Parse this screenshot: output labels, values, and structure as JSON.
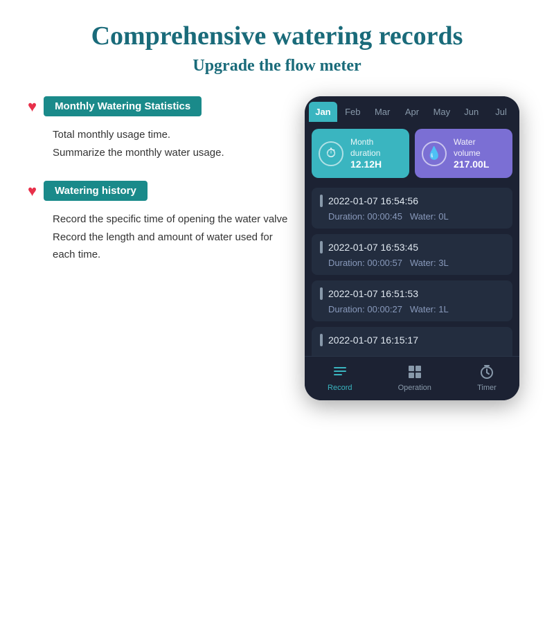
{
  "header": {
    "main_title": "Comprehensive watering records",
    "subtitle": "Upgrade the flow meter"
  },
  "features": [
    {
      "id": "monthly-stats",
      "badge": "Monthly Watering Statistics",
      "description_line1": "Total monthly usage time.",
      "description_line2": "Summarize the monthly water usage."
    },
    {
      "id": "watering-history",
      "badge": "Watering history",
      "description_line1": "Record the specific time of opening the water valve",
      "description_line2": "Record the length and amount of water used for each time."
    }
  ],
  "phone": {
    "months": [
      "Jan",
      "Feb",
      "Mar",
      "Apr",
      "May",
      "Jun",
      "Jul"
    ],
    "active_month": "Jan",
    "stats": [
      {
        "label": "Month\nduration",
        "value": "12.12H",
        "type": "teal",
        "icon": "⏱"
      },
      {
        "label": "Water\nvolume",
        "value": "217.00L",
        "type": "purple",
        "icon": "💧"
      }
    ],
    "history": [
      {
        "datetime": "2022-01-07 16:54:56",
        "duration": "00:00:45",
        "water": "0L"
      },
      {
        "datetime": "2022-01-07 16:53:45",
        "duration": "00:00:57",
        "water": "3L"
      },
      {
        "datetime": "2022-01-07 16:51:53",
        "duration": "00:00:27",
        "water": "1L"
      },
      {
        "datetime": "2022-01-07 16:15:17",
        "duration": "",
        "water": ""
      }
    ],
    "nav": [
      {
        "label": "Record",
        "icon": "☰",
        "active": true
      },
      {
        "label": "Operation",
        "icon": "⊞",
        "active": false
      },
      {
        "label": "Timer",
        "icon": "⏰",
        "active": false
      }
    ]
  }
}
